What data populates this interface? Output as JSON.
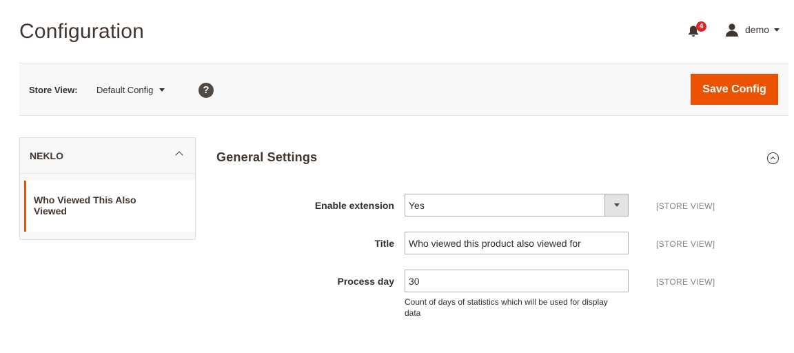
{
  "header": {
    "title": "Configuration",
    "notifications": {
      "count": "4",
      "icon": "bell-icon"
    },
    "user": {
      "name": "demo",
      "icon": "user-icon"
    }
  },
  "store_bar": {
    "label": "Store View:",
    "selected": "Default Config",
    "help_icon": "question-icon",
    "help_glyph": "?",
    "save_label": "Save Config"
  },
  "sidebar": {
    "group_label": "NEKLO",
    "items": [
      {
        "label": "Who Viewed This Also Viewed",
        "active": true
      }
    ]
  },
  "section": {
    "title": "General Settings",
    "fields": [
      {
        "label": "Enable extension",
        "type": "select",
        "value": "Yes",
        "scope": "[STORE VIEW]"
      },
      {
        "label": "Title",
        "type": "text",
        "value": "Who viewed this product also viewed for",
        "scope": "[STORE VIEW]"
      },
      {
        "label": "Process day",
        "type": "text",
        "value": "30",
        "scope": "[STORE VIEW]",
        "note": "Count of days of statistics which will be used for display data"
      }
    ]
  },
  "colors": {
    "accent": "#eb5202",
    "badge": "#e22626",
    "text": "#41362f",
    "bar_bg": "#f8f8f8"
  }
}
